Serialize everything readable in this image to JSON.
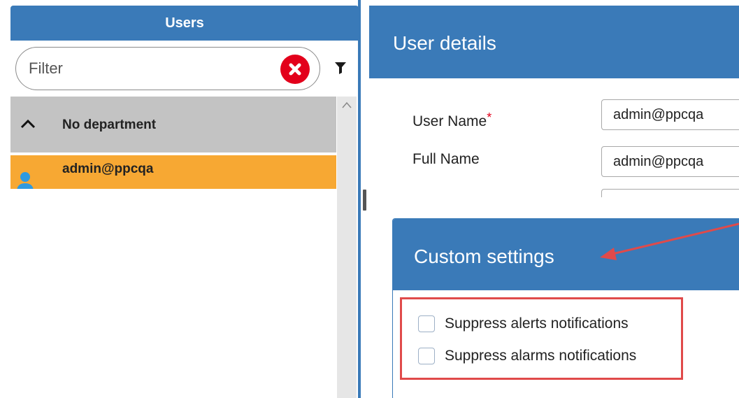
{
  "left_panel": {
    "title": "Users",
    "filter": {
      "placeholder": "Filter",
      "value": "",
      "clear_icon": "clear-icon",
      "filter_icon": "funnel-icon"
    },
    "groups": [
      {
        "label": "No department",
        "expanded": true,
        "icon": "chevron-up-icon",
        "users": [
          {
            "label": "admin@ppcqa",
            "icon": "user-icon",
            "selected": true
          }
        ]
      }
    ]
  },
  "right_panel": {
    "title": "User details",
    "fields": [
      {
        "label": "User Name",
        "required_mark": "*",
        "value": "admin@ppcqa"
      },
      {
        "label": "Full Name",
        "value": "admin@ppcqa"
      }
    ],
    "custom_settings": {
      "title": "Custom settings",
      "options": [
        {
          "label": "Suppress alerts notifications",
          "checked": false
        },
        {
          "label": "Suppress alarms notifications",
          "checked": false
        }
      ]
    }
  },
  "colors": {
    "header_blue": "#3a7ab8",
    "selected_row": "#f7a833",
    "group_row": "#c3c3c3",
    "annotation_red": "#e04a4a",
    "clear_red": "#e3001b"
  }
}
